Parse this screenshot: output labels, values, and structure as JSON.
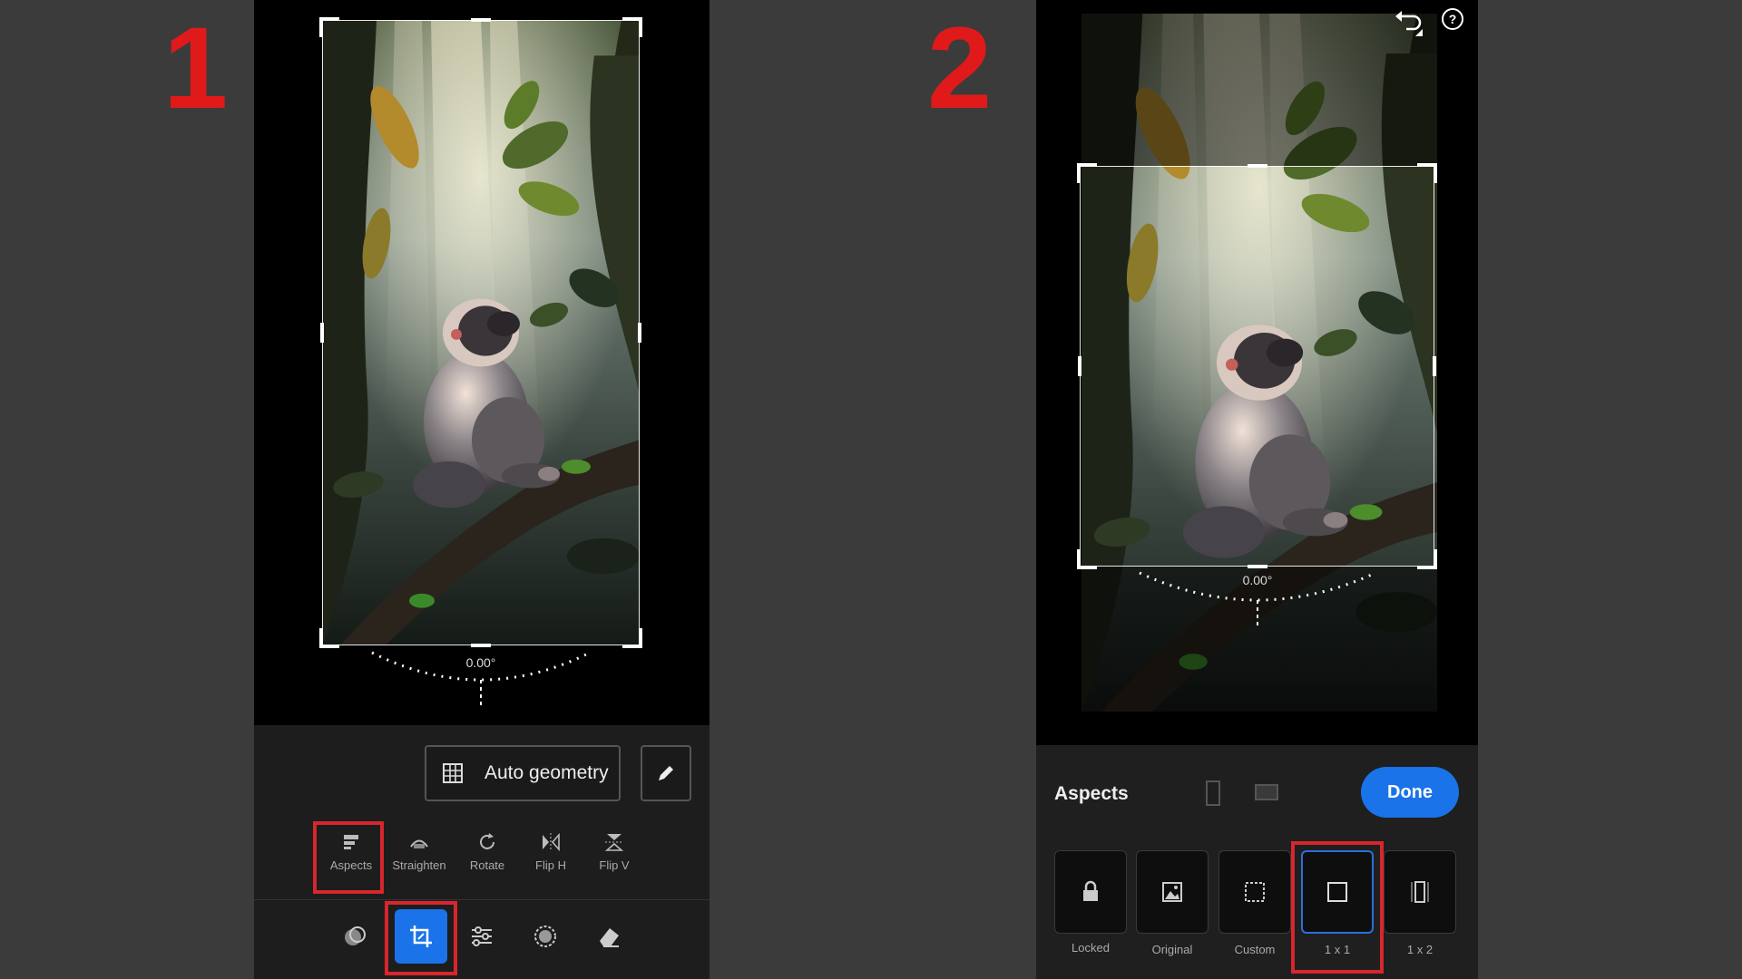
{
  "steps": {
    "one": "1",
    "two": "2"
  },
  "left": {
    "angle": "0.00°",
    "auto_geometry": "Auto geometry",
    "tools": [
      {
        "label": "Aspects",
        "icon": "aspects-icon"
      },
      {
        "label": "Straighten",
        "icon": "straighten-icon"
      },
      {
        "label": "Rotate",
        "icon": "rotate-icon"
      },
      {
        "label": "Flip H",
        "icon": "flip-h-icon"
      },
      {
        "label": "Flip V",
        "icon": "flip-v-icon"
      }
    ],
    "bottom_icons": [
      "presets-icon",
      "crop-icon",
      "adjustments-icon",
      "effects-icon",
      "eraser-icon"
    ]
  },
  "right": {
    "angle": "0.00°",
    "panel_title": "Aspects",
    "done_label": "Done",
    "aspects": [
      {
        "label": "Locked",
        "icon": "lock-icon"
      },
      {
        "label": "Original",
        "icon": "image-icon"
      },
      {
        "label": "Custom",
        "icon": "custom-frame-icon"
      },
      {
        "label": "1 x 1",
        "icon": "square-icon"
      },
      {
        "label": "1 x 2",
        "icon": "portrait-icon"
      }
    ]
  },
  "colors": {
    "accent": "#1a73e8",
    "highlight": "#d7262d",
    "step_number": "#e01a1a"
  }
}
